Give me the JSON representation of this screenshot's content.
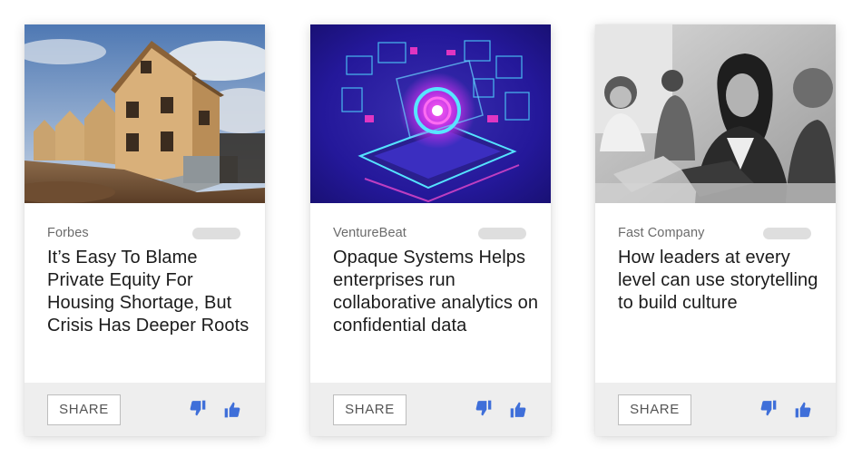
{
  "colors": {
    "accent": "#3f6fd9",
    "footer_bg": "#eeeeee",
    "pill": "#dedede"
  },
  "cards": [
    {
      "source": "Forbes",
      "title": "It’s Easy To Blame Private Equity For Housing Shortage, But Crisis Has Deeper Roots",
      "image_icon": "construction-houses-image",
      "share_label": "SHARE"
    },
    {
      "source": "VentureBeat",
      "title": "Opaque Systems Helps enterprises run collaborative analytics on confidential data",
      "image_icon": "laptop-data-image",
      "share_label": "SHARE"
    },
    {
      "source": "Fast Company",
      "title": "How leaders at every level can use storytelling to build culture",
      "image_icon": "office-meeting-image",
      "share_label": "SHARE"
    }
  ],
  "icons": {
    "dislike": "thumbs-down-icon",
    "like": "thumbs-up-icon"
  }
}
